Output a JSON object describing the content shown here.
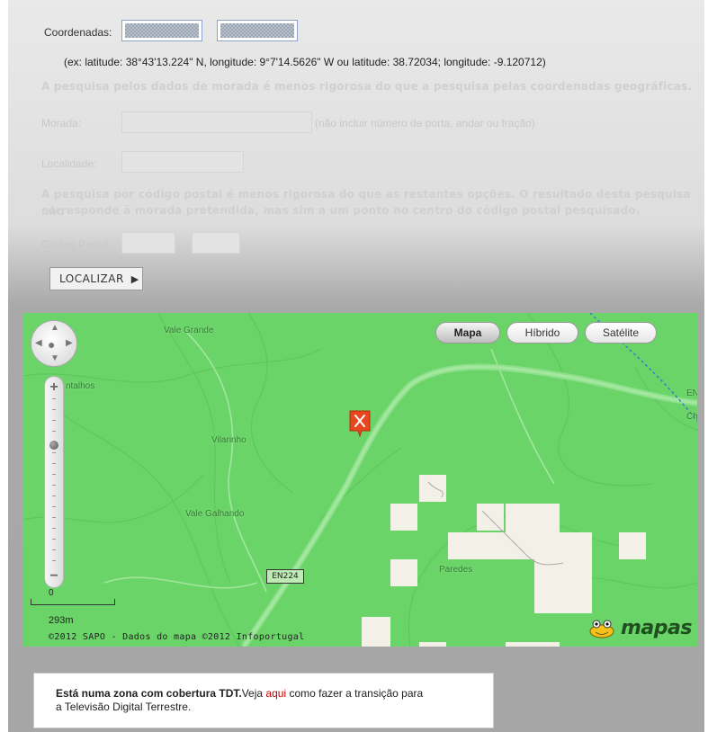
{
  "form": {
    "coords_label": "Coordenadas:",
    "example": "(ex: latitude: 38°43'13.224\" N, longitude: 9°7'14.5626\" W ou latitude: 38.72034; longitude: -9.120712)",
    "address_note": "A pesquisa pelos dados de morada é menos rigorosa do que a pesquisa pelas coordenadas geográficas.",
    "morada_label": "Morada:",
    "morada_hint": "(não incluir número de porta, andar ou fração)",
    "localidade_label": "Localidade:",
    "postal_note_line1": "A pesquisa por código postal é menos rigorosa do que as restantes opções. O resultado desta pesquisa não",
    "postal_note_line2": "corresponde à morada pretendida, mas sim a um ponto no centro do código postal pesquisado.",
    "postal_label": "Código Postal:",
    "postal_separator": "-",
    "submit_label": "LOCALIZAR",
    "submit_icon": "play-arrow-icon"
  },
  "map": {
    "type_buttons": [
      {
        "label": "Mapa",
        "active": true
      },
      {
        "label": "Híbrido",
        "active": false
      },
      {
        "label": "Satélite",
        "active": false
      }
    ],
    "places": [
      "Vale Grande",
      "ntalhos",
      "Vilarinho",
      "Vale Galhando",
      "Paredes",
      "EN",
      "Ch"
    ],
    "road_tag": "EN224",
    "zoom": {
      "in": "+",
      "out": "−"
    },
    "scale_zero": "0",
    "scale_distance": "293m",
    "copyright": "©2012 SAPO - Dados do mapa ©2012 Infoportugal",
    "logo_text": "mapas",
    "marker_icon": "location-marker-icon",
    "colors": {
      "land": "#6bd469",
      "road": "#8fe08c",
      "marker": "#e8461e"
    }
  },
  "info": {
    "bold_text": "Está numa zona com cobertura TDT.",
    "text_before_link": "Veja ",
    "link_text": "aqui",
    "text_after_link": " como fazer a transição para",
    "line2": "a Televisão Digital Terrestre."
  }
}
